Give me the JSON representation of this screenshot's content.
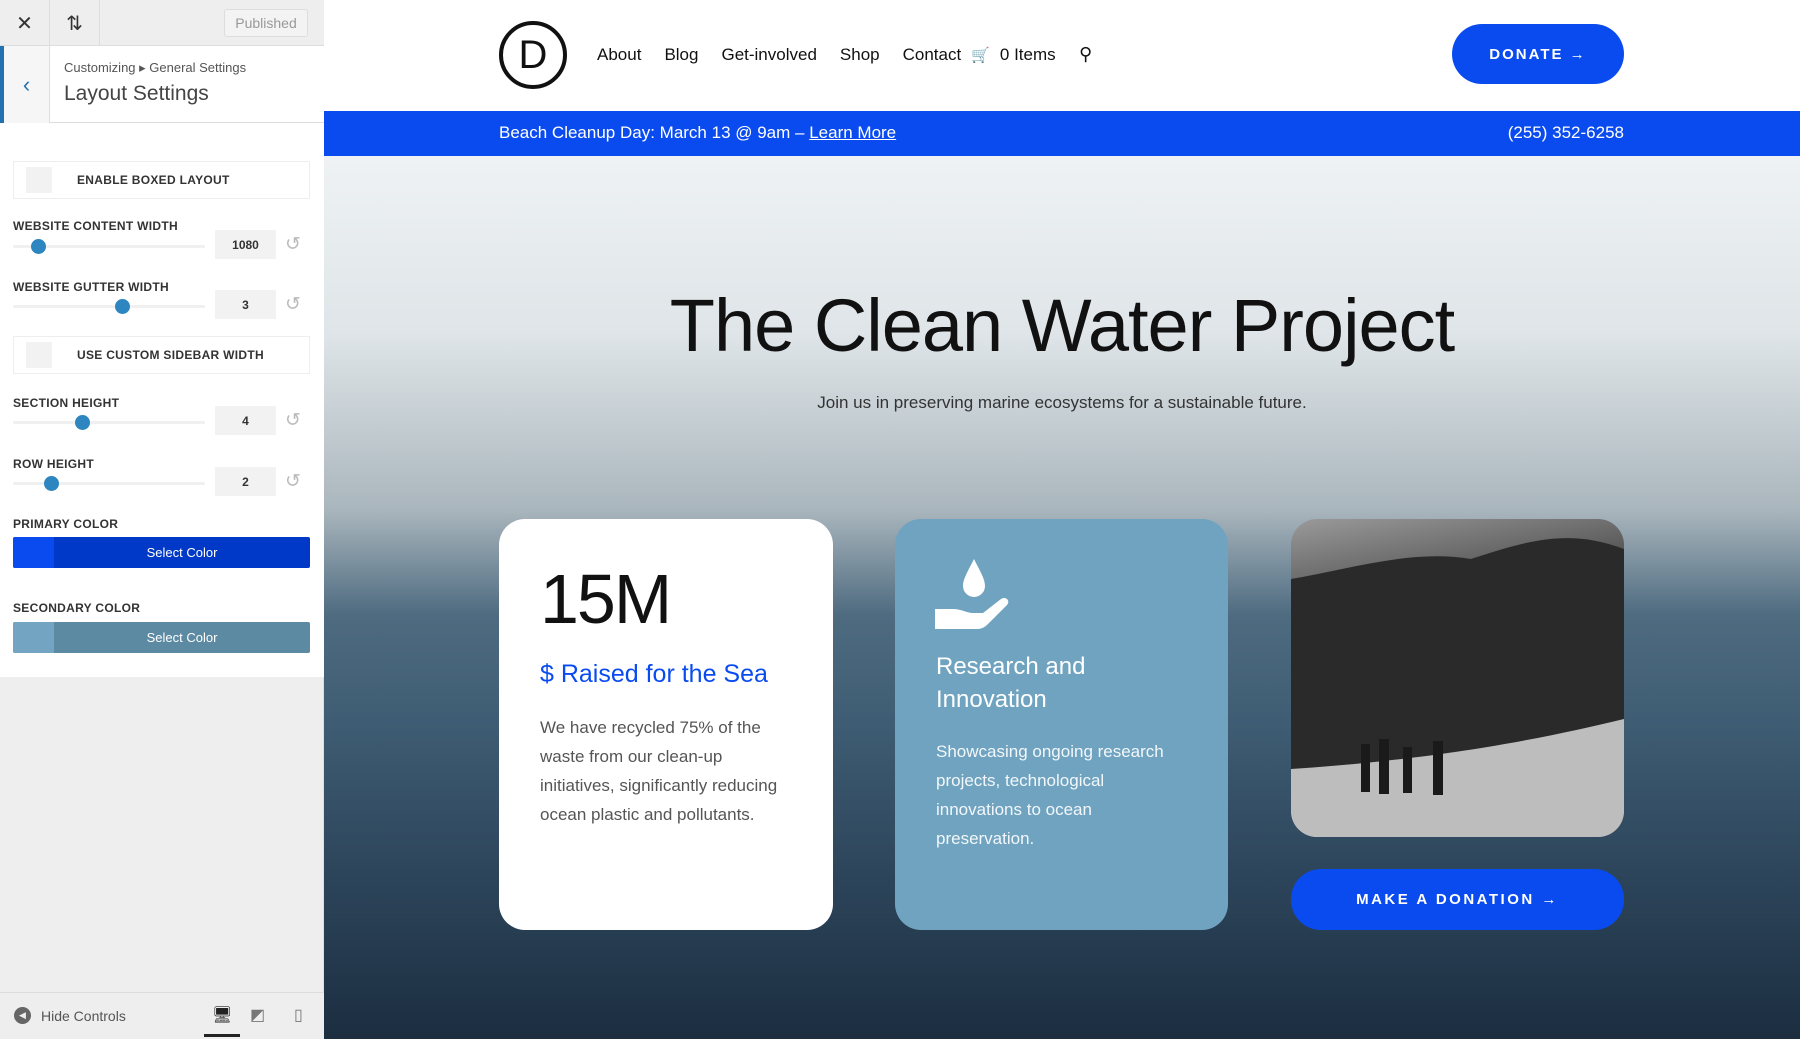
{
  "sidebar": {
    "close_icon": "close-icon",
    "sort_icon": "arrows-up-down-icon",
    "published": "Published",
    "breadcrumb": "Customizing ▸ General Settings",
    "title": "Layout Settings",
    "enable_boxed": "ENABLE BOXED LAYOUT",
    "content_width": {
      "label": "WEBSITE CONTENT WIDTH",
      "value": "1080",
      "fraction": 0.13
    },
    "gutter_width": {
      "label": "WEBSITE GUTTER WIDTH",
      "value": "3",
      "fraction": 0.57
    },
    "custom_sidebar": "USE CUSTOM SIDEBAR WIDTH",
    "section_height": {
      "label": "SECTION HEIGHT",
      "value": "4",
      "fraction": 0.36
    },
    "row_height": {
      "label": "ROW HEIGHT",
      "value": "2",
      "fraction": 0.2
    },
    "primary_color": {
      "label": "PRIMARY COLOR",
      "button": "Select Color",
      "color": "#0a4bf0"
    },
    "secondary_color": {
      "label": "SECONDARY COLOR",
      "button": "Select Color",
      "color": "#5c8aa3"
    },
    "hide_controls": "Hide Controls"
  },
  "header": {
    "logo": "D",
    "nav": [
      "About",
      "Blog",
      "Get-involved",
      "Shop",
      "Contact"
    ],
    "cart": "0 Items",
    "donate": "DONATE →"
  },
  "promo": {
    "text": "Beach Cleanup Day: March 13 @ 9am – ",
    "link": "Learn More",
    "phone": "(255) 352-6258"
  },
  "hero": {
    "title": "The Clean Water Project",
    "subtitle": "Join us in preserving marine ecosystems for a sustainable future.",
    "card1": {
      "stat": "15M",
      "heading": "$ Raised for the Sea",
      "body": "We have recycled 75% of the waste from our clean-up initiatives, significantly reducing ocean plastic and pollutants."
    },
    "card2": {
      "heading": "Research and Innovation",
      "body": "Showcasing ongoing research projects, technological innovations to ocean preservation."
    },
    "cta": "MAKE A DONATION →"
  },
  "colors": {
    "accent": "#0a4bf0",
    "card_blue": "#6fa3c0"
  }
}
